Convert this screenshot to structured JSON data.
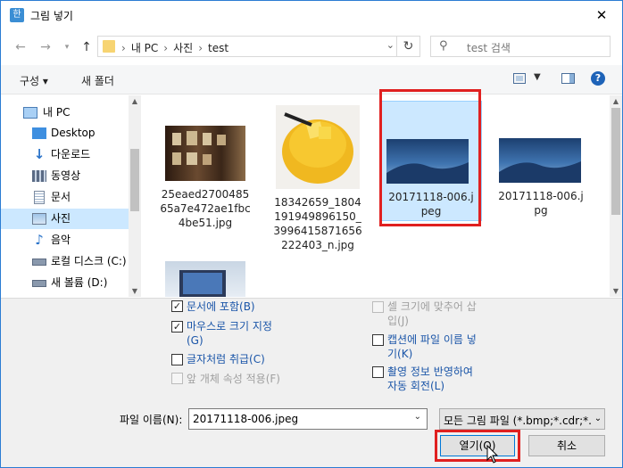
{
  "window": {
    "title": "그림 넣기",
    "app_icon": "hwp-icon"
  },
  "address_bar": {
    "crumbs": [
      "내 PC",
      "사진",
      "test"
    ],
    "search_placeholder": "test 검색"
  },
  "toolbar": {
    "organize_label": "구성 ▾",
    "new_folder_label": "새 폴더"
  },
  "nav_pane": {
    "items": [
      {
        "label": "내 PC",
        "icon": "pc-icon",
        "selected": false
      },
      {
        "label": "Desktop",
        "icon": "desktop-folder-icon",
        "selected": false
      },
      {
        "label": "다운로드",
        "icon": "download-icon",
        "selected": false
      },
      {
        "label": "동영상",
        "icon": "video-icon",
        "selected": false
      },
      {
        "label": "문서",
        "icon": "document-icon",
        "selected": false
      },
      {
        "label": "사진",
        "icon": "pictures-icon",
        "selected": true
      },
      {
        "label": "음악",
        "icon": "music-icon",
        "selected": false
      },
      {
        "label": "로컬 디스크 (C:)",
        "icon": "drive-icon",
        "selected": false
      },
      {
        "label": "새 볼륨 (D:)",
        "icon": "drive-icon",
        "selected": false
      }
    ]
  },
  "files": [
    {
      "name_lines": [
        "25eaed2700485",
        "65a7e472ae1fbc",
        "4be51.jpg"
      ],
      "selected": false
    },
    {
      "name_lines": [
        "18342659_1804",
        "191949896150_",
        "3996415871656",
        "222403_n.jpg"
      ],
      "selected": false
    },
    {
      "name_lines": [
        "20171118-006.j",
        "peg"
      ],
      "selected": true
    },
    {
      "name_lines": [
        "20171118-006.j",
        "pg"
      ],
      "selected": false
    },
    {
      "name_lines": [],
      "selected": false
    }
  ],
  "options": {
    "embed": {
      "label": "문서에 포함(B)",
      "checked": true,
      "enabled": true
    },
    "mouse_size": {
      "label1": "마우스로 크기 지정",
      "label2": "(G)",
      "checked": true,
      "enabled": true
    },
    "as_char": {
      "label": "글자처럼 취급(C)",
      "checked": false,
      "enabled": true
    },
    "prev_attr": {
      "label": "앞 개체 속성 적용(F)",
      "checked": false,
      "enabled": false
    },
    "fit_cell": {
      "label1": "셀 크기에 맞추어 삽",
      "label2": "입(J)",
      "checked": false,
      "enabled": false
    },
    "caption_name": {
      "label1": "캡션에 파일 이름 넣",
      "label2": "기(K)",
      "checked": false,
      "enabled": true
    },
    "exif_rotate": {
      "label1": "촬영 정보 반영하여",
      "label2": "자동 회전(L)",
      "checked": false,
      "enabled": true
    }
  },
  "filename": {
    "label": "파일 이름(N):",
    "value": "20171118-006.jpeg",
    "filter": "모든 그림 파일 (*.bmp;*.cdr;*.c"
  },
  "buttons": {
    "open": "열기(O)",
    "cancel": "취소"
  },
  "colors": {
    "accent": "#0078d7",
    "highlight": "#e02020",
    "selection": "#cce8ff",
    "option_text": "#1a55a8"
  }
}
